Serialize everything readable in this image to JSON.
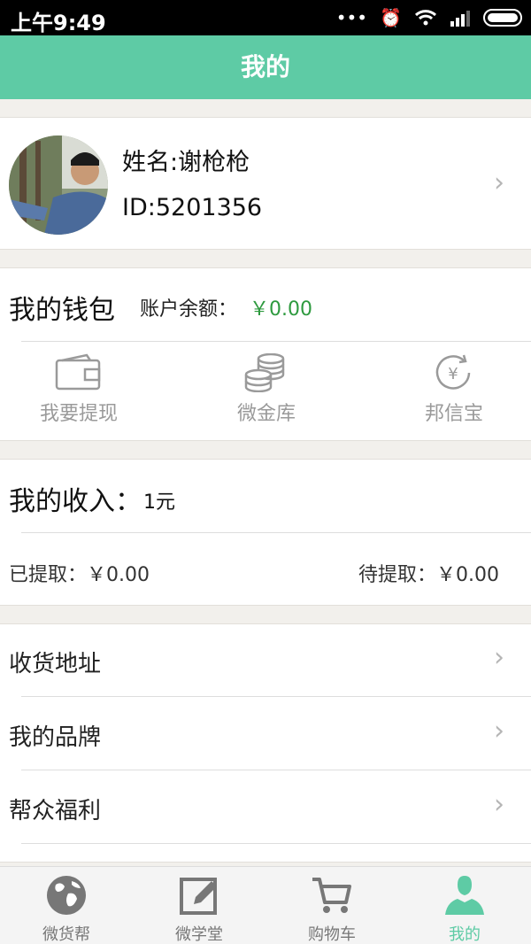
{
  "status_bar": {
    "time": "上午9:49",
    "icons": [
      "more-icon",
      "alarm-icon",
      "wifi-icon",
      "signal-icon",
      "battery-icon"
    ]
  },
  "header": {
    "title": "我的"
  },
  "profile": {
    "name": "姓名:谢枪枪",
    "id": "ID:5201356"
  },
  "wallet": {
    "title": "我的钱包",
    "balance_label": "账户余额：",
    "balance_value": "￥0.00",
    "items": [
      {
        "label": "我要提现",
        "icon": "wallet-icon"
      },
      {
        "label": "微金库",
        "icon": "coins-icon"
      },
      {
        "label": "邦信宝",
        "icon": "yuan-refresh-icon"
      }
    ]
  },
  "income": {
    "title": "我的收入：",
    "amount": "1元",
    "withdrawn": "已提取：￥0.00",
    "pending": "待提取：￥0.00"
  },
  "menu": [
    {
      "label": "收货地址"
    },
    {
      "label": "我的品牌"
    },
    {
      "label": "帮众福利"
    }
  ],
  "tabs": [
    {
      "label": "微货帮",
      "icon": "globe-icon"
    },
    {
      "label": "微学堂",
      "icon": "edit-icon"
    },
    {
      "label": "购物车",
      "icon": "cart-icon"
    },
    {
      "label": "我的",
      "icon": "person-icon",
      "active": true
    }
  ],
  "colors": {
    "accent": "#5ecba5",
    "balance": "#2e9a3f"
  }
}
